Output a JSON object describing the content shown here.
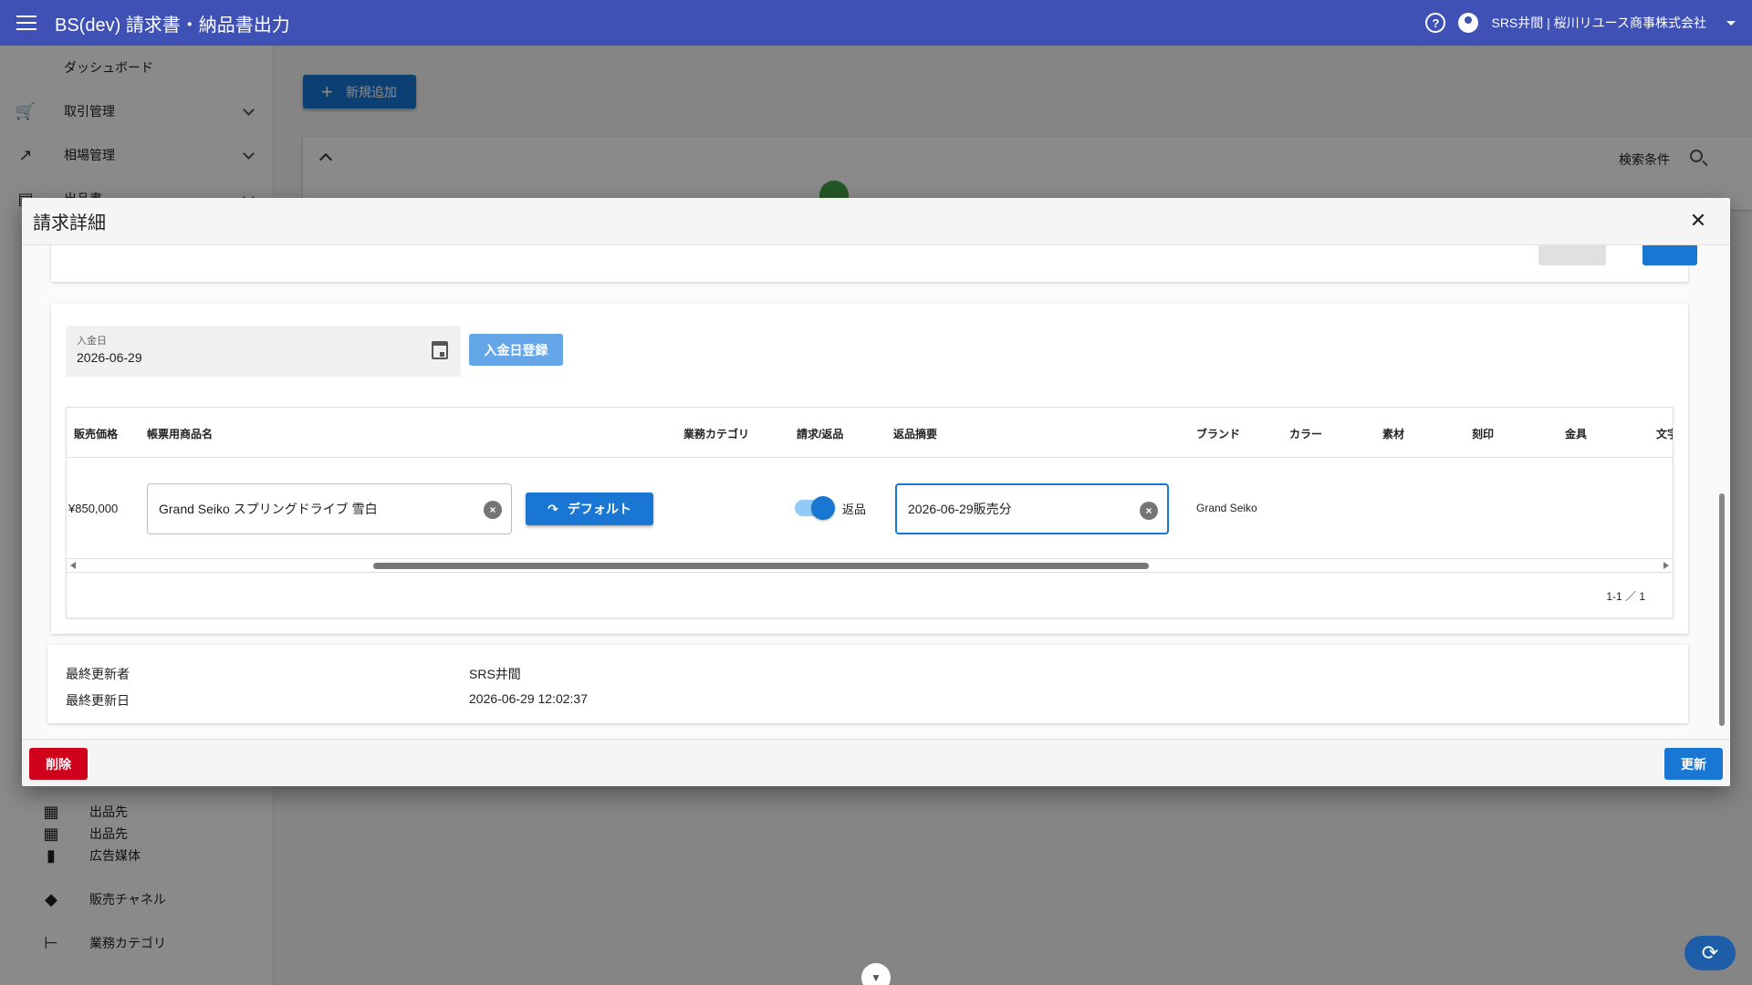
{
  "appbar": {
    "title": "BS(dev) 請求書・納品書出力",
    "help_icon": "help-circle-icon",
    "user_label": "SRS井間 | 桜川リユース商事株式会社"
  },
  "sidebar": {
    "items": [
      {
        "label": "ダッシュボード",
        "icon": "dashboard-icon"
      },
      {
        "label": "取引管理",
        "icon": "cart-icon"
      },
      {
        "label": "相場管理",
        "icon": "trending-up-icon"
      },
      {
        "label": "出品書",
        "icon": "list-icon"
      }
    ],
    "sub_items": [
      {
        "label": "出品先",
        "icon": "archive-icon"
      },
      {
        "label": "広告媒体",
        "icon": "document-icon"
      },
      {
        "label": "販売チャネル",
        "icon": "tag-icon"
      },
      {
        "label": "業務カテゴリ",
        "icon": "hierarchy-icon"
      }
    ]
  },
  "main": {
    "add_button_label": "新規追加",
    "search_conditions_label": "検索条件"
  },
  "dialog": {
    "title": "請求詳細",
    "payment_date": {
      "label": "入金日",
      "value": "2026-06-29"
    },
    "register_button": "入金日登録",
    "table": {
      "headers": [
        "販売価格",
        "帳票用商品名",
        "業務カテゴリ",
        "請求/返品",
        "返品摘要",
        "ブランド",
        "カラー",
        "素材",
        "刻印",
        "金具",
        "文字"
      ],
      "row": {
        "price": "¥850,000",
        "product_name": "Grand Seiko スプリングドライブ 雪白",
        "default_button": "デフォルト",
        "return_toggle_label": "返品",
        "return_toggle_on": true,
        "return_memo": "2026-06-29販売分",
        "brand": "Grand Seiko"
      },
      "pagination": "1-1 ／ 1"
    },
    "meta": {
      "last_updated_by_label": "最終更新者",
      "last_updated_by": "SRS井間",
      "last_updated_at_label": "最終更新日",
      "last_updated_at": "2026-06-29 12:02:37"
    },
    "delete_button": "削除",
    "update_button": "更新"
  },
  "colors": {
    "appbar": "#3f51b5",
    "primary": "#1976d2",
    "danger": "#d0021b"
  }
}
